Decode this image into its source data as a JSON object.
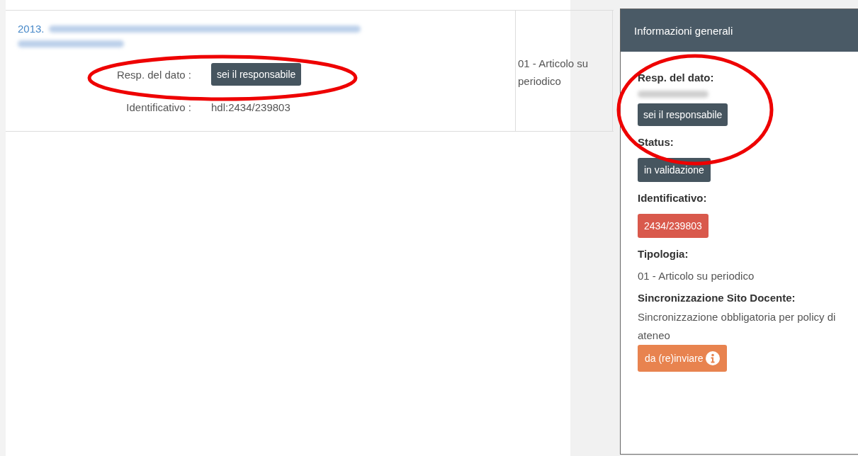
{
  "table": {
    "rows": [
      {
        "title_prefix": "2013.",
        "fields": [
          {
            "label": "Resp. del dato :",
            "kind": "button",
            "value": "sei il responsabile"
          },
          {
            "label": "Identificativo :",
            "kind": "text",
            "value": "hdl:2434/239803"
          }
        ],
        "tipologia": "01 - Articolo su periodico"
      }
    ]
  },
  "panel": {
    "title": "Informazioni generali",
    "sections": [
      {
        "label": "Resp. del dato:",
        "kind": "owner",
        "button": "sei il responsabile"
      },
      {
        "label": "Status:",
        "kind": "badge",
        "value": "in validazione",
        "color": "#46555f"
      },
      {
        "label": "Identificativo:",
        "kind": "badge",
        "value": "2434/239803",
        "color": "#d9594c"
      },
      {
        "label": "Tipologia:",
        "kind": "text",
        "value": "01 - Articolo su periodico"
      },
      {
        "label": "Sincronizzazione Sito Docente:",
        "kind": "sync",
        "value": "Sincronizzazione obbligatoria per policy di ateneo",
        "button": "da (re)inviare"
      }
    ]
  }
}
